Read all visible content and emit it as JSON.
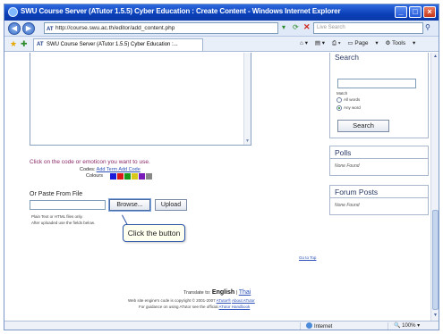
{
  "window": {
    "title": "SWU Course Server (ATutor 1.5.5) Cyber Education : Create Content - Windows Internet Explorer"
  },
  "toolbar": {
    "address": "http://course.swu.ac.th/editor/add_content.php",
    "search_placeholder": "Live Search",
    "tab_label": "SWU Course Server (ATutor 1.5.5) Cyber Education :...",
    "page_label": "Page",
    "tools_label": "Tools"
  },
  "editor": {
    "click_hint": "Click on the code or emoticon you want to use.",
    "codes_label": "Codes:",
    "codes_links": "Add Term Add Code",
    "colours_label": "Colours",
    "colours": [
      "#1a1ad8",
      "#d81a1a",
      "#1a9a1a",
      "#d8c81a",
      "#7a1ab8",
      "#888888"
    ],
    "paste_label": "Or Paste From File",
    "browse_label": "Browse...",
    "upload_label": "Upload",
    "plain_note": "Plain Text or HTML files only.",
    "after_note": "After uploaded use the fields below.",
    "callout": "Click the button"
  },
  "footer": {
    "go_to_top": "Go to Top",
    "translate_prefix": "Translate to:",
    "lang_en": "English",
    "lang_th": "Thai",
    "copyright_pre": "Web site engine's code is copyright © 2001-2007",
    "atutor_link": "ATutor®",
    "about_link": "About ATutor",
    "guidance_pre": "For guidance on using ATutor see the official",
    "handbook_link": "ATutor Handbook"
  },
  "sidebar": {
    "search_title": "Search",
    "match_label": "Match",
    "radio_all": "All words",
    "radio_any": "Any word",
    "search_button": "Search",
    "polls_title": "Polls",
    "polls_none": "None Found",
    "forum_title": "Forum Posts",
    "forum_none": "None Found"
  },
  "status": {
    "zone": "Internet",
    "zoom": "100%"
  }
}
